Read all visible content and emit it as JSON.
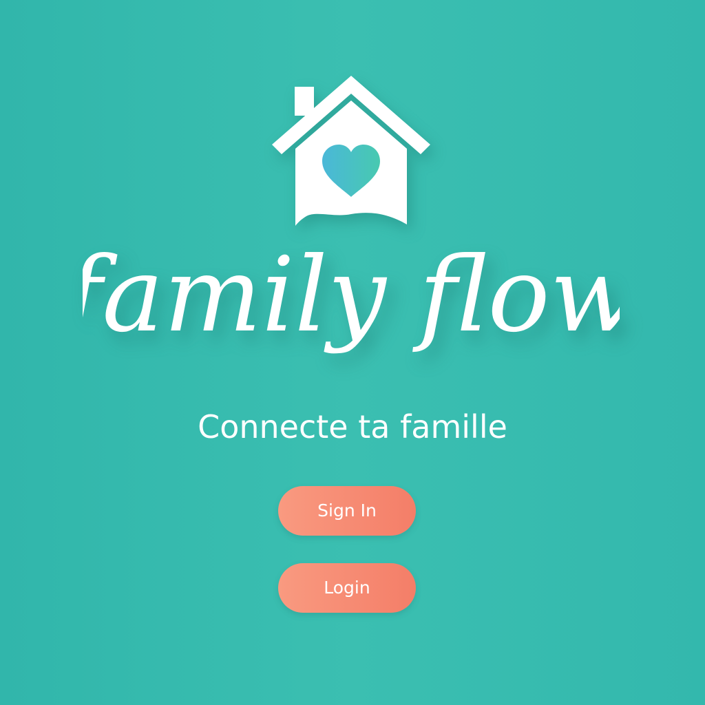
{
  "brand": {
    "logo_icon": "house-heart-icon",
    "name": "family flow"
  },
  "tagline": "Connecte ta famille",
  "actions": {
    "signin_label": "Sign In",
    "login_label": "Login"
  },
  "colors": {
    "background": "#37bbaf",
    "button_start": "#f99a80",
    "button_end": "#f47e68",
    "heart_start": "#4ab8d8",
    "heart_end": "#48c9b0",
    "foreground": "#ffffff"
  }
}
